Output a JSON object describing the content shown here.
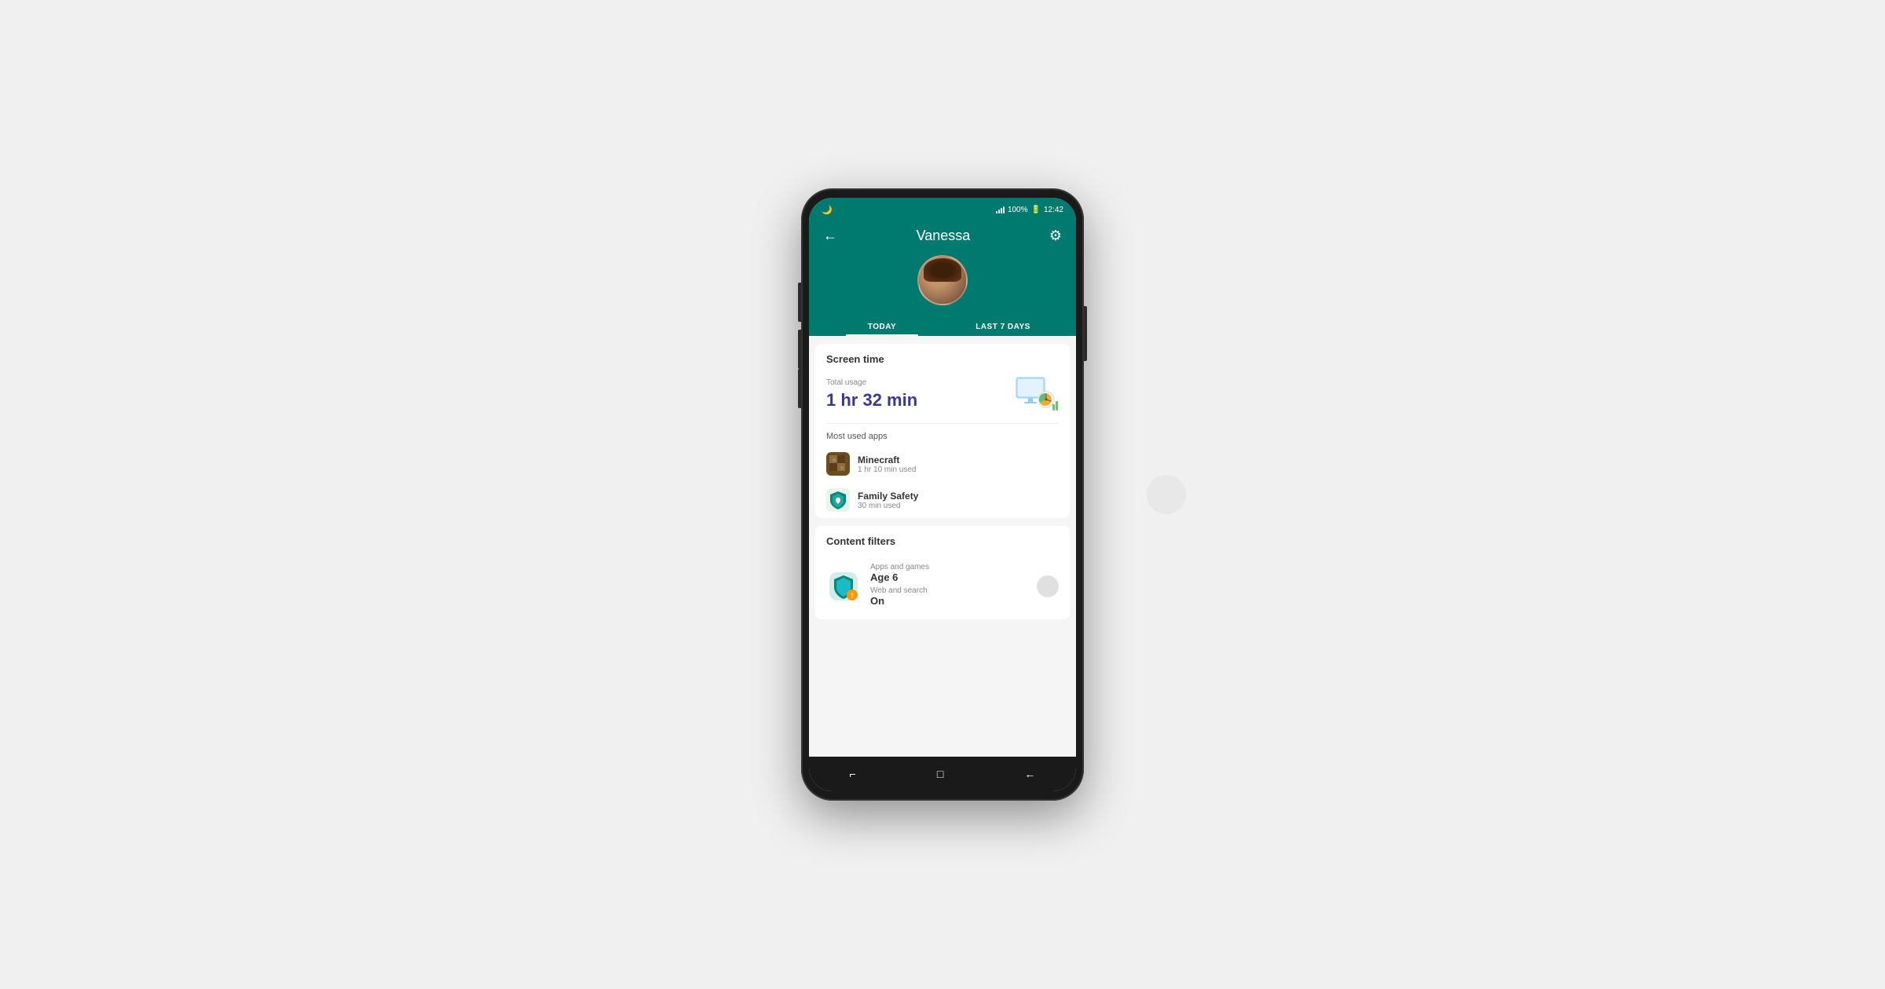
{
  "statusBar": {
    "leftIcon": "🌙",
    "signal": "signal",
    "battery": "100%",
    "time": "12:42"
  },
  "header": {
    "backLabel": "←",
    "title": "Vanessa",
    "settingsLabel": "⚙"
  },
  "tabs": [
    {
      "label": "TODAY",
      "active": true
    },
    {
      "label": "LAST 7 DAYS",
      "active": false
    }
  ],
  "screenTime": {
    "sectionTitle": "Screen time",
    "totalUsageLabel": "Total usage",
    "totalUsageValue": "1 hr 32 min",
    "mostUsedLabel": "Most used apps",
    "apps": [
      {
        "name": "Minecraft",
        "time": "1 hr 10 min used"
      },
      {
        "name": "Family Safety",
        "time": "30 min used"
      }
    ]
  },
  "contentFilters": {
    "sectionTitle": "Content filters",
    "appsLabel": "Apps and games",
    "ageValue": "Age 6",
    "webLabel": "Web and search",
    "webValue": "On"
  },
  "bottomNav": {
    "recentIcon": "⌐",
    "homeIcon": "□",
    "backIcon": "←"
  }
}
